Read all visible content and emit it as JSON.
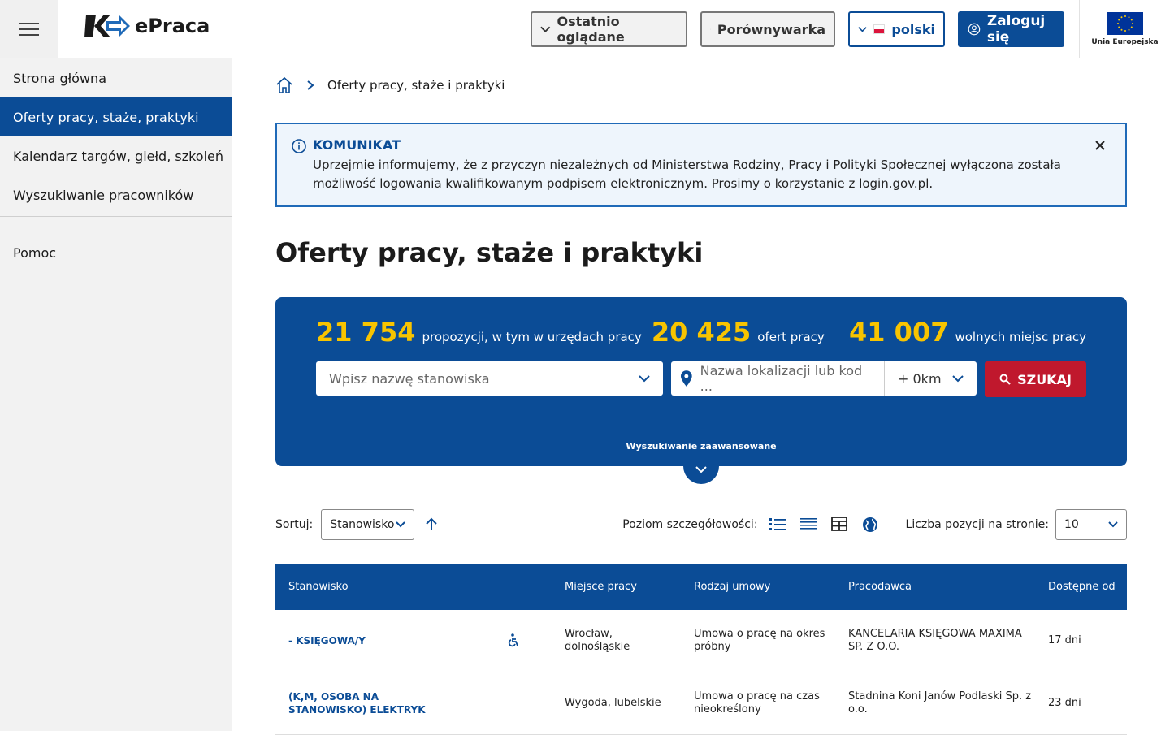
{
  "header": {
    "logo_text": "ePraca",
    "recent_label": "Ostatnio oglądane",
    "compare_label": "Porównywarka",
    "language_label": "polski",
    "login_label": "Zaloguj się",
    "eu_label": "Unia Europejska"
  },
  "sidebar": {
    "items": [
      {
        "label": "Strona główna"
      },
      {
        "label": "Oferty pracy, staże, praktyki"
      },
      {
        "label": "Kalendarz targów, giełd, szkoleń"
      },
      {
        "label": "Wyszukiwanie pracowników"
      }
    ],
    "help_label": "Pomoc"
  },
  "breadcrumb": {
    "current": "Oferty pracy, staże i praktyki"
  },
  "notice": {
    "title": "KOMUNIKAT",
    "text": "Uprzejmie informujemy, że z przyczyn niezależnych od Ministerstwa Rodziny, Pracy i Polityki Społecznej wyłączona została możliwość logowania kwalifikowanym podpisem elektronicznym. Prosimy o korzystanie z login.gov.pl."
  },
  "page_title": "Oferty pracy, staże i praktyki",
  "search": {
    "proposals_count": "21 754",
    "proposals_text": "propozycji, w tym w urzędach pracy",
    "offers_count": "20 425",
    "offers_text": "ofert pracy",
    "vacancies_count": "41 007",
    "vacancies_text": "wolnych miejsc pracy",
    "position_placeholder": "Wpisz nazwę stanowiska",
    "location_placeholder": "Nazwa lokalizacji lub kod ...",
    "radius_value": "+ 0km",
    "search_button": "SZUKAJ",
    "advanced_label": "Wyszukiwanie zaawansowane"
  },
  "toolbar": {
    "sort_label": "Sortuj:",
    "sort_value": "Stanowisko",
    "detail_label": "Poziom szczegółowości:",
    "per_page_label": "Liczba pozycji na stronie:",
    "per_page_value": "10"
  },
  "table": {
    "headers": [
      "Stanowisko",
      "Miejsce pracy",
      "Rodzaj umowy",
      "Pracodawca",
      "Dostępne od"
    ],
    "rows": [
      {
        "position": "- KSIĘGOWA/Y",
        "place_line1": "Wrocław,",
        "place_line2": "dolnośląskie",
        "contract_line1": "Umowa o pracę na okres",
        "contract_line2": "próbny",
        "employer_line1": "KANCELARIA KSIĘGOWA MAXIMA",
        "employer_line2": "SP. Z O.O.",
        "available": "17 dni"
      },
      {
        "position_line1": "(K,M, OSOBA NA",
        "position_line2": "STANOWISKO) ELEKTRYK",
        "place_line1": "Wygoda, lubelskie",
        "contract_line1": "Umowa o pracę na czas",
        "contract_line2": "nieokreślony",
        "employer_line1": "Stadnina Koni Janów Podlaski Sp. z",
        "employer_line2": "o.o.",
        "available": "23 dni"
      }
    ]
  },
  "colors": {
    "brand": "#0b4c96",
    "highlight": "#f8c400",
    "search_button": "#c0182d"
  }
}
